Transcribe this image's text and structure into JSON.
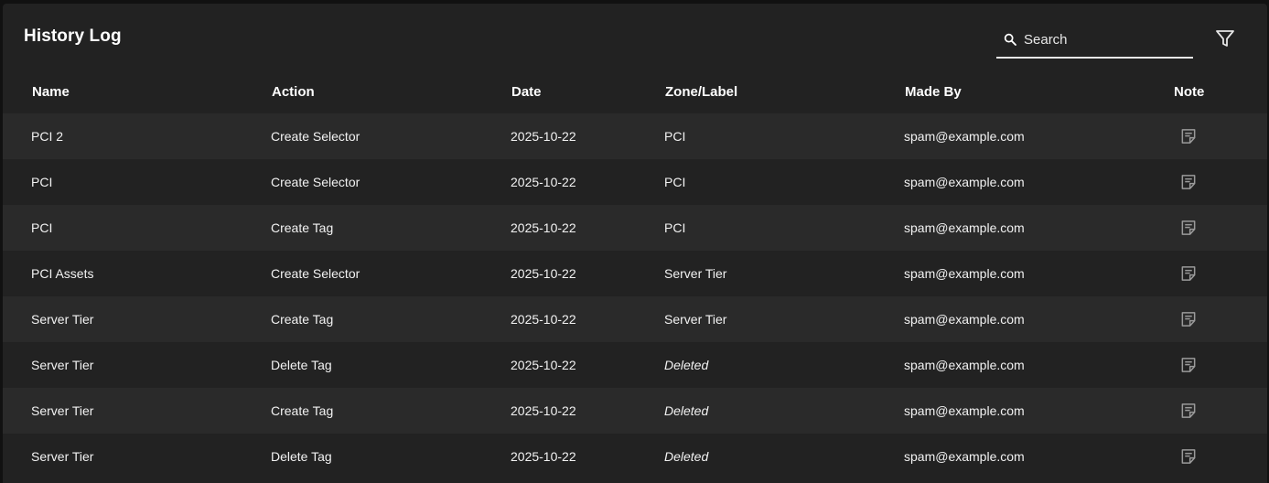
{
  "header": {
    "title": "History Log",
    "search_placeholder": "Search"
  },
  "icons": {
    "search": "search-icon",
    "filter": "filter-icon",
    "note": "note-icon"
  },
  "table": {
    "columns": [
      "Name",
      "Action",
      "Date",
      "Zone/Label",
      "Made By",
      "Note"
    ],
    "rows": [
      {
        "name": "PCI 2",
        "action": "Create Selector",
        "date": "2025-10-22",
        "zone": "PCI",
        "zone_deleted": false,
        "made_by": "spam@example.com"
      },
      {
        "name": "PCI",
        "action": "Create Selector",
        "date": "2025-10-22",
        "zone": "PCI",
        "zone_deleted": false,
        "made_by": "spam@example.com"
      },
      {
        "name": "PCI",
        "action": "Create Tag",
        "date": "2025-10-22",
        "zone": "PCI",
        "zone_deleted": false,
        "made_by": "spam@example.com"
      },
      {
        "name": "PCI Assets",
        "action": "Create Selector",
        "date": "2025-10-22",
        "zone": "Server Tier",
        "zone_deleted": false,
        "made_by": "spam@example.com"
      },
      {
        "name": "Server Tier",
        "action": "Create Tag",
        "date": "2025-10-22",
        "zone": "Server Tier",
        "zone_deleted": false,
        "made_by": "spam@example.com"
      },
      {
        "name": "Server Tier",
        "action": "Delete Tag",
        "date": "2025-10-22",
        "zone": "Deleted",
        "zone_deleted": true,
        "made_by": "spam@example.com"
      },
      {
        "name": "Server Tier",
        "action": "Create Tag",
        "date": "2025-10-22",
        "zone": "Deleted",
        "zone_deleted": true,
        "made_by": "spam@example.com"
      },
      {
        "name": "Server Tier",
        "action": "Delete Tag",
        "date": "2025-10-22",
        "zone": "Deleted",
        "zone_deleted": true,
        "made_by": "spam@example.com"
      }
    ]
  },
  "colors": {
    "background": "#222222",
    "row_alt": "#2a2a2a",
    "text": "#f2f2f2",
    "icon_muted": "#9a9a9a"
  }
}
